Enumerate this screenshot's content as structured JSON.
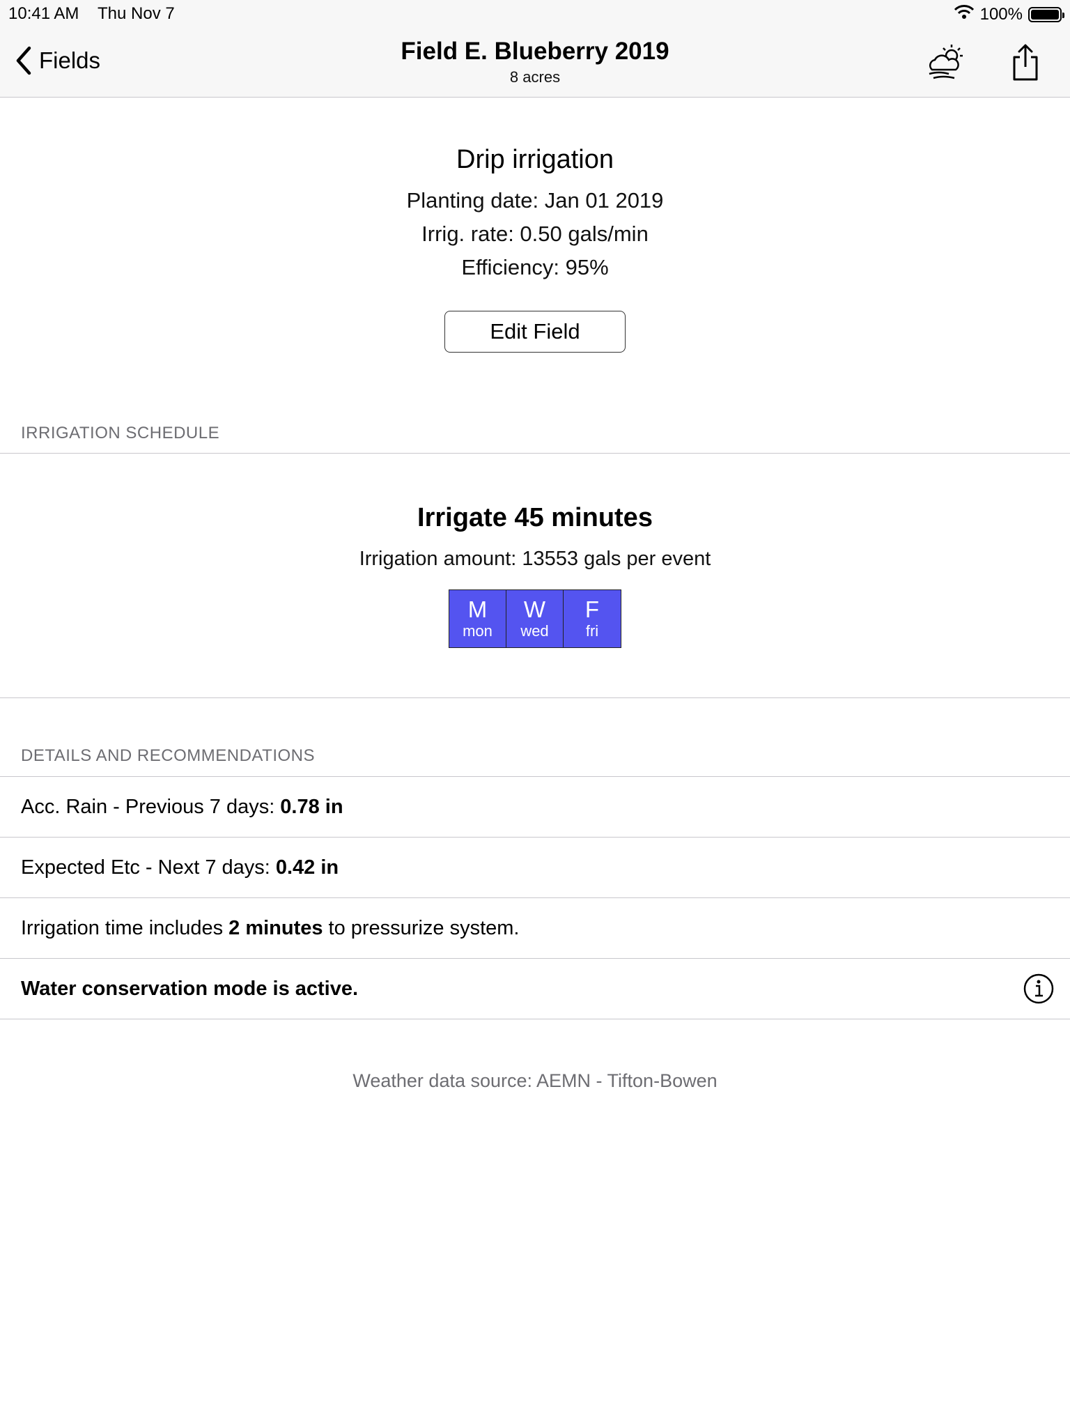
{
  "status_bar": {
    "time": "10:41 AM",
    "date": "Thu Nov 7",
    "battery": "100%",
    "icons": [
      "wifi-icon",
      "battery-icon"
    ]
  },
  "nav": {
    "back_label": "Fields",
    "title": "Field E. Blueberry 2019",
    "subtitle": "8 acres",
    "icons": [
      "chevron-left-icon",
      "weather-icon",
      "share-icon"
    ]
  },
  "field": {
    "irrigation_type": "Drip irrigation",
    "planting_date": "Planting date: Jan 01 2019",
    "irrig_rate": "Irrig. rate: 0.50 gals/min",
    "efficiency": "Efficiency: 95%",
    "edit_label": "Edit Field"
  },
  "schedule": {
    "header": "IRRIGATION SCHEDULE",
    "title": "Irrigate 45 minutes",
    "amount": "Irrigation amount: 13553 gals per event",
    "days": [
      {
        "letter": "M",
        "name": "mon"
      },
      {
        "letter": "W",
        "name": "wed"
      },
      {
        "letter": "F",
        "name": "fri"
      }
    ],
    "day_color": "#5454f0"
  },
  "details": {
    "header": "DETAILS AND RECOMMENDATIONS",
    "rain_label": "Acc. Rain - Previous 7 days:",
    "rain_value": "0.78 in",
    "etc_label": "Expected Etc - Next 7 days:",
    "etc_value": "0.42 in",
    "pressurize_prefix": "Irrigation time includes",
    "pressurize_value": "2 minutes",
    "pressurize_suffix": "to pressurize system.",
    "conservation": "Water conservation mode is active.",
    "info_icon": "info-icon"
  },
  "footer": {
    "source": "Weather data source: AEMN - Tifton-Bowen"
  }
}
